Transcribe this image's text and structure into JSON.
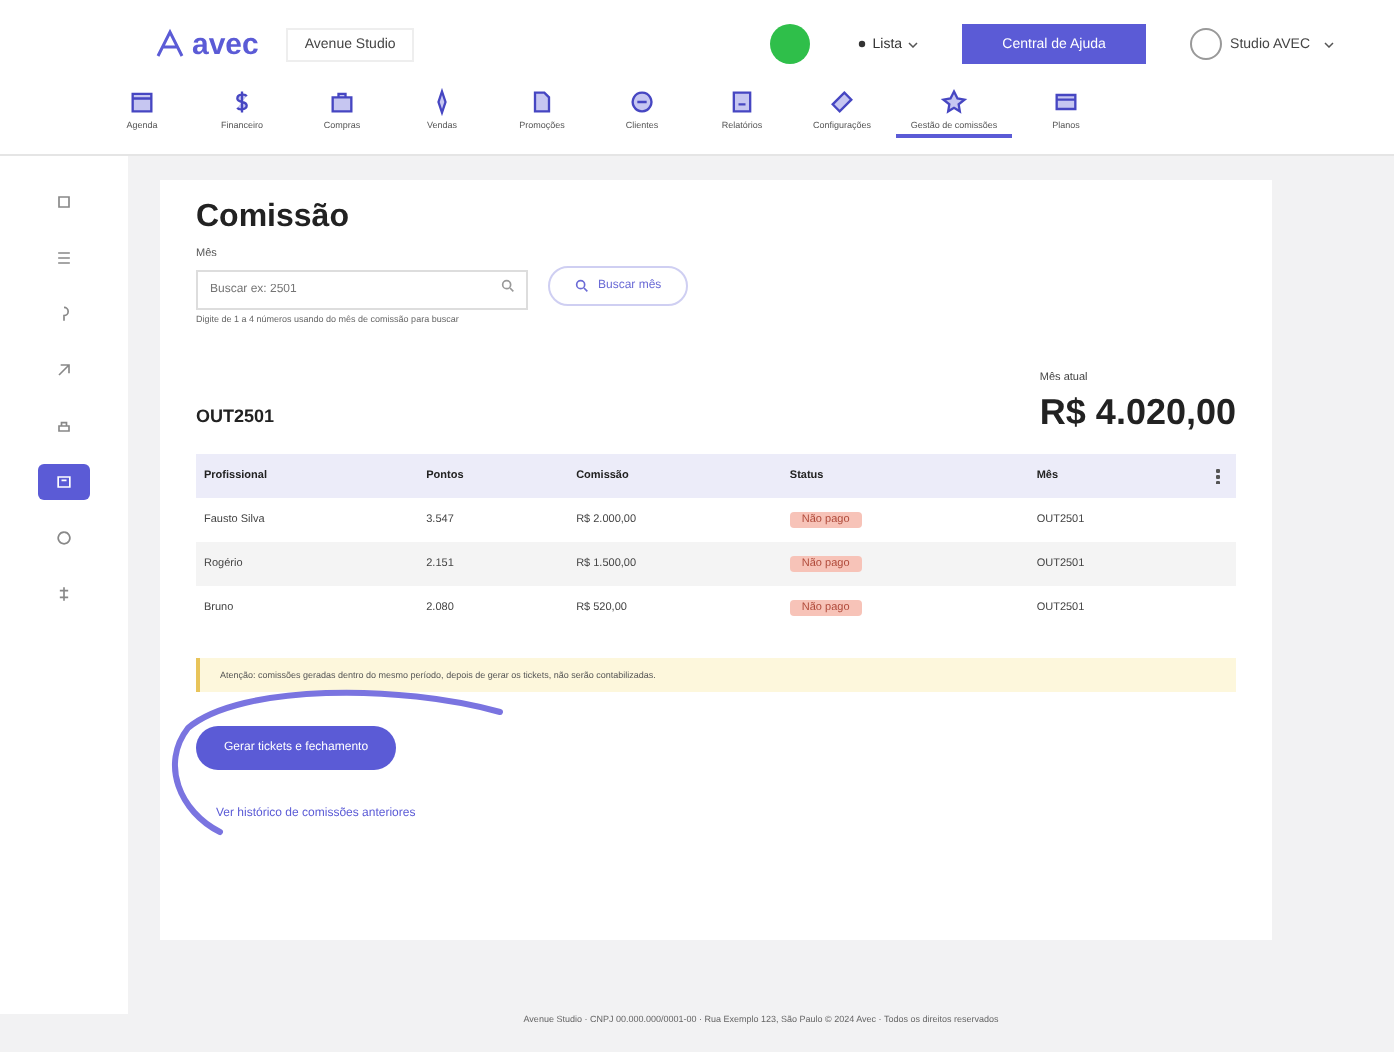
{
  "header": {
    "logo": "avec",
    "salon": "Avenue Studio",
    "location": "Lista",
    "help_button": "Central de Ajuda",
    "user": "Studio AVEC"
  },
  "nav": [
    {
      "label": "Agenda",
      "selected": false
    },
    {
      "label": "Financeiro",
      "selected": false
    },
    {
      "label": "Compras",
      "selected": false
    },
    {
      "label": "Vendas",
      "selected": false
    },
    {
      "label": "Promoções",
      "selected": false
    },
    {
      "label": "Clientes",
      "selected": false
    },
    {
      "label": "Relatórios",
      "selected": false
    },
    {
      "label": "Configurações",
      "selected": false
    },
    {
      "label": "Gestão de comissões",
      "selected": true
    },
    {
      "label": "Planos",
      "selected": false
    }
  ],
  "sidebar": [
    {
      "selected": false
    },
    {
      "selected": false
    },
    {
      "selected": false
    },
    {
      "selected": false
    },
    {
      "selected": false
    },
    {
      "selected": true
    },
    {
      "selected": false
    },
    {
      "selected": false
    }
  ],
  "page": {
    "title": "Comissão",
    "field_label": "Mês",
    "placeholder": "Buscar ex: 2501",
    "search_button": "Buscar mês",
    "hint": "Digite de 1 a 4 números usando do mês de comissão para buscar",
    "period": "OUT2501",
    "total_label": "Mês atual",
    "total": "R$ 4.020,00"
  },
  "table": {
    "columns": [
      "Profissional",
      "Pontos",
      "Comissão",
      "Status",
      "Mês"
    ],
    "rows": [
      {
        "cells": [
          "Fausto Silva",
          "3.547",
          "R$ 2.000,00",
          "Não pago",
          "OUT2501"
        ]
      },
      {
        "cells": [
          "Rogério",
          "2.151",
          "R$ 1.500,00",
          "Não pago",
          "OUT2501"
        ]
      },
      {
        "cells": [
          "Bruno",
          "2.080",
          "R$ 520,00",
          "Não pago",
          "OUT2501"
        ]
      }
    ]
  },
  "notice": "Atenção: comissões geradas dentro do mesmo período, depois de gerar os tickets, não serão contabilizadas.",
  "primary_button": "Gerar tickets e fechamento",
  "link": "Ver histórico de comissões anteriores",
  "footer": "Avenue Studio · CNPJ 00.000.000/0001-00 · Rua Exemplo 123, São Paulo © 2024 Avec · Todos os direitos reservados"
}
